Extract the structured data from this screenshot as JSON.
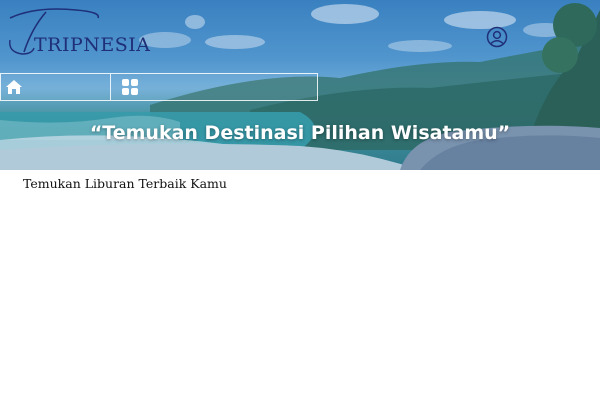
{
  "brand": {
    "name": "TRIPNESIA"
  },
  "header": {
    "user_icon": "user-circle-icon"
  },
  "navbar": {
    "items": [
      {
        "icon": "home-icon"
      },
      {
        "icon": "grid-icon"
      }
    ]
  },
  "hero": {
    "tagline": "“Temukan Destinasi Pilihan Wisatamu”"
  },
  "main": {
    "subtitle": "Temukan Liburan Terbaik Kamu"
  },
  "colors": {
    "brand": "#1f2f78",
    "sky": "#5aa0d4",
    "sea": "#2f7f86"
  }
}
